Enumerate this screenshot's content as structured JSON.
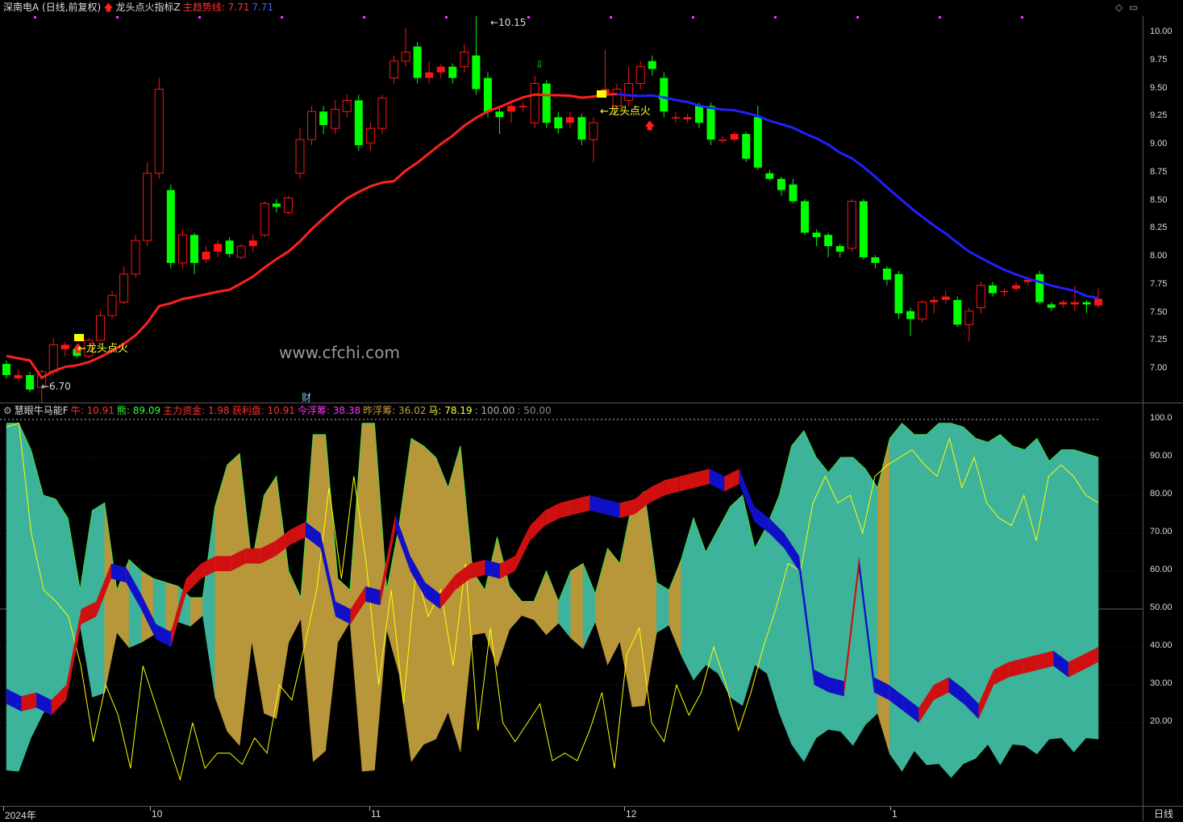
{
  "colors": {
    "up": "#ff1414",
    "down": "#00ff00",
    "trend_up": "#ff2020",
    "trend_down": "#2020ff",
    "gold": "#b8973a",
    "teal": "#3cb39a",
    "yellow": "#ffff00"
  },
  "main_panel": {
    "stock_label": "深南电A (日线,前复权)",
    "indicator_label": "龙头点火指标Z",
    "trend_label": "主趋势线: 7.71",
    "trend_value": "7.71",
    "arrow_icon": "red-up-arrow",
    "ticks": [
      "10.00",
      "9.75",
      "9.50",
      "9.25",
      "9.00",
      "8.75",
      "8.50",
      "8.25",
      "8.00",
      "7.75",
      "7.50",
      "7.25",
      "7.00"
    ],
    "high_note": "10.15",
    "low_note": "6.70",
    "signal_text_1": "龙头点火",
    "signal_text_2": "龙头点火",
    "watermark": "www.cfchi.com",
    "fin_marker": "财"
  },
  "sub_panel": {
    "name": "慧眼牛马能F",
    "items": [
      {
        "label": "牛: 10.91",
        "color": "#ff3030"
      },
      {
        "label": "熊: 89.09",
        "color": "#33ff33"
      },
      {
        "label": "主力资金: 1.98",
        "color": "#ff3030"
      },
      {
        "label": "获利盘: 10.91",
        "color": "#ff3030"
      },
      {
        "label": "今浮筹: 38.38",
        "color": "#ff33ff"
      },
      {
        "label": "昨浮筹: 36.02",
        "color": "#c8a040"
      },
      {
        "label": "马: 78.19",
        "color": "#ffff33"
      },
      {
        "label": ": 100.00",
        "color": "#aaaaaa"
      },
      {
        "label": ": 50.00",
        "color": "#888888"
      }
    ],
    "ticks": [
      "100.0",
      "90.00",
      "80.00",
      "70.00",
      "60.00",
      "50.00",
      "40.00",
      "30.00",
      "20.00"
    ]
  },
  "date_axis": {
    "labels": [
      "2024年",
      "10",
      "11",
      "12",
      "1"
    ],
    "period": "日线"
  },
  "chart_data": {
    "type": "candlestick",
    "series": [
      {
        "name": "主趋势线",
        "last": 7.71
      }
    ],
    "ylim": [
      6.7,
      10.15
    ],
    "candles": [
      [
        7.05,
        6.95,
        7.08,
        6.92
      ],
      [
        6.92,
        6.95,
        7.0,
        6.9
      ],
      [
        6.95,
        6.82,
        6.98,
        6.8
      ],
      [
        6.84,
        6.98,
        7.0,
        6.7
      ],
      [
        6.98,
        7.22,
        7.28,
        6.95
      ],
      [
        7.18,
        7.22,
        7.25,
        7.12
      ],
      [
        7.18,
        7.12,
        7.2,
        7.1
      ],
      [
        7.12,
        7.26,
        7.28,
        7.1
      ],
      [
        7.26,
        7.48,
        7.52,
        7.25
      ],
      [
        7.48,
        7.66,
        7.7,
        7.45
      ],
      [
        7.6,
        7.85,
        7.92,
        7.58
      ],
      [
        7.85,
        8.15,
        8.2,
        7.82
      ],
      [
        8.15,
        8.75,
        8.85,
        8.1
      ],
      [
        8.75,
        9.5,
        9.6,
        8.7
      ],
      [
        8.6,
        7.95,
        8.65,
        7.9
      ],
      [
        7.95,
        8.2,
        8.25,
        7.9
      ],
      [
        8.2,
        7.95,
        8.22,
        7.85
      ],
      [
        7.98,
        8.05,
        8.1,
        7.95
      ],
      [
        8.05,
        8.12,
        8.15,
        8.0
      ],
      [
        8.15,
        8.03,
        8.18,
        8.0
      ],
      [
        8.0,
        8.1,
        8.12,
        7.98
      ],
      [
        8.1,
        8.15,
        8.2,
        8.05
      ],
      [
        8.2,
        8.48,
        8.5,
        8.18
      ],
      [
        8.48,
        8.45,
        8.52,
        8.4
      ],
      [
        8.4,
        8.53,
        8.55,
        8.38
      ],
      [
        8.75,
        9.05,
        9.15,
        8.7
      ],
      [
        9.05,
        9.3,
        9.35,
        9.0
      ],
      [
        9.3,
        9.18,
        9.35,
        9.1
      ],
      [
        9.15,
        9.32,
        9.4,
        9.1
      ],
      [
        9.3,
        9.4,
        9.45,
        9.25
      ],
      [
        9.4,
        9.0,
        9.45,
        8.95
      ],
      [
        9.02,
        9.15,
        9.2,
        8.95
      ],
      [
        9.15,
        9.42,
        9.45,
        9.1
      ],
      [
        9.6,
        9.75,
        9.8,
        9.55
      ],
      [
        9.75,
        9.83,
        10.05,
        9.7
      ],
      [
        9.88,
        9.6,
        9.92,
        9.55
      ],
      [
        9.6,
        9.65,
        9.75,
        9.55
      ],
      [
        9.65,
        9.7,
        9.72,
        9.6
      ],
      [
        9.7,
        9.6,
        9.73,
        9.55
      ],
      [
        9.7,
        9.83,
        9.9,
        9.65
      ],
      [
        9.8,
        9.5,
        10.15,
        9.45
      ],
      [
        9.6,
        9.3,
        9.65,
        9.25
      ],
      [
        9.3,
        9.25,
        9.35,
        9.1
      ],
      [
        9.3,
        9.35,
        9.4,
        9.2
      ],
      [
        9.35,
        9.35,
        9.38,
        9.3
      ],
      [
        9.2,
        9.55,
        9.62,
        9.15
      ],
      [
        9.55,
        9.2,
        9.58,
        9.15
      ],
      [
        9.25,
        9.15,
        9.3,
        9.1
      ],
      [
        9.2,
        9.25,
        9.3,
        9.15
      ],
      [
        9.25,
        9.05,
        9.28,
        9.0
      ],
      [
        9.05,
        9.2,
        9.25,
        8.85
      ],
      [
        9.45,
        9.5,
        9.85,
        9.42
      ],
      [
        9.35,
        9.5,
        9.55,
        9.3
      ],
      [
        9.4,
        9.55,
        9.7,
        9.35
      ],
      [
        9.55,
        9.7,
        9.75,
        9.5
      ],
      [
        9.75,
        9.68,
        9.8,
        9.62
      ],
      [
        9.6,
        9.3,
        9.65,
        9.25
      ],
      [
        9.25,
        9.25,
        9.3,
        9.2
      ],
      [
        9.23,
        9.25,
        9.28,
        9.2
      ],
      [
        9.35,
        9.2,
        9.38,
        9.15
      ],
      [
        9.35,
        9.05,
        9.38,
        9.0
      ],
      [
        9.05,
        9.05,
        9.08,
        9.02
      ],
      [
        9.05,
        9.1,
        9.12,
        9.03
      ],
      [
        9.1,
        8.88,
        9.12,
        8.85
      ],
      [
        9.25,
        8.8,
        9.35,
        8.78
      ],
      [
        8.75,
        8.7,
        8.78,
        8.68
      ],
      [
        8.7,
        8.6,
        8.72,
        8.55
      ],
      [
        8.65,
        8.5,
        8.7,
        8.48
      ],
      [
        8.5,
        8.22,
        8.52,
        8.2
      ],
      [
        8.22,
        8.18,
        8.25,
        8.1
      ],
      [
        8.2,
        8.1,
        8.22,
        8.0
      ],
      [
        8.1,
        8.05,
        8.12,
        8.0
      ],
      [
        8.08,
        8.5,
        8.52,
        8.05
      ],
      [
        8.5,
        8.0,
        8.52,
        7.98
      ],
      [
        8.0,
        7.95,
        8.02,
        7.9
      ],
      [
        7.9,
        7.8,
        7.92,
        7.75
      ],
      [
        7.85,
        7.5,
        7.88,
        7.45
      ],
      [
        7.52,
        7.45,
        7.55,
        7.3
      ],
      [
        7.45,
        7.6,
        7.62,
        7.42
      ],
      [
        7.6,
        7.62,
        7.65,
        7.5
      ],
      [
        7.62,
        7.65,
        7.7,
        7.58
      ],
      [
        7.62,
        7.4,
        7.65,
        7.38
      ],
      [
        7.4,
        7.52,
        7.55,
        7.25
      ],
      [
        7.55,
        7.75,
        7.78,
        7.5
      ],
      [
        7.75,
        7.68,
        7.78,
        7.65
      ],
      [
        7.7,
        7.7,
        7.72,
        7.65
      ],
      [
        7.72,
        7.75,
        7.78,
        7.7
      ],
      [
        7.78,
        7.8,
        7.82,
        7.75
      ],
      [
        7.85,
        7.6,
        7.88,
        7.58
      ],
      [
        7.58,
        7.55,
        7.6,
        7.52
      ],
      [
        7.58,
        7.6,
        7.62,
        7.55
      ],
      [
        7.58,
        7.6,
        7.75,
        7.52
      ],
      [
        7.6,
        7.58,
        7.62,
        7.5
      ],
      [
        7.57,
        7.63,
        7.72,
        7.55
      ]
    ]
  }
}
